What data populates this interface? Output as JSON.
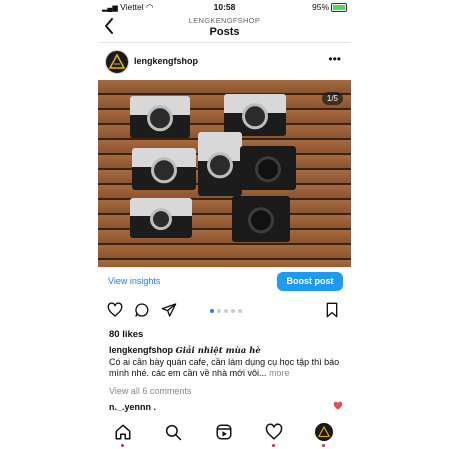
{
  "status_bar": {
    "carrier": "Viettel",
    "time": "10:58",
    "battery": "95%"
  },
  "nav": {
    "account": "LENGKENGFSHOP",
    "title": "Posts"
  },
  "post": {
    "username": "lengkengfshop",
    "image_counter": "1/5",
    "carousel": {
      "count": 5,
      "active_index": 0
    },
    "view_insights": "View insights",
    "boost_button": "Boost post",
    "likes": "80 likes",
    "caption_user": "lengkengfshop",
    "caption_heading": "Giải nhiệt mùa hè",
    "caption_text": "Có ai cần bày quán cafe, cần làm dụng cụ học tập thì báo mình nhé. các em cần về nhà mới vôi...",
    "caption_more": "more",
    "view_comments": "View all 6 comments",
    "comment_user": "n._.yennn ."
  },
  "icons": {
    "back": "chevron-left-icon",
    "more": "more-horizontal-icon",
    "like": "heart-icon",
    "comment": "comment-icon",
    "share": "send-icon",
    "save": "bookmark-icon",
    "tabs": [
      "home-icon",
      "search-icon",
      "reels-icon",
      "activity-heart-icon",
      "profile-avatar"
    ]
  },
  "colors": {
    "accent": "#1d7ff0",
    "boost_bg": "#1d9bf0",
    "notification": "#e0245e",
    "comment_heart": "#ed4956"
  }
}
